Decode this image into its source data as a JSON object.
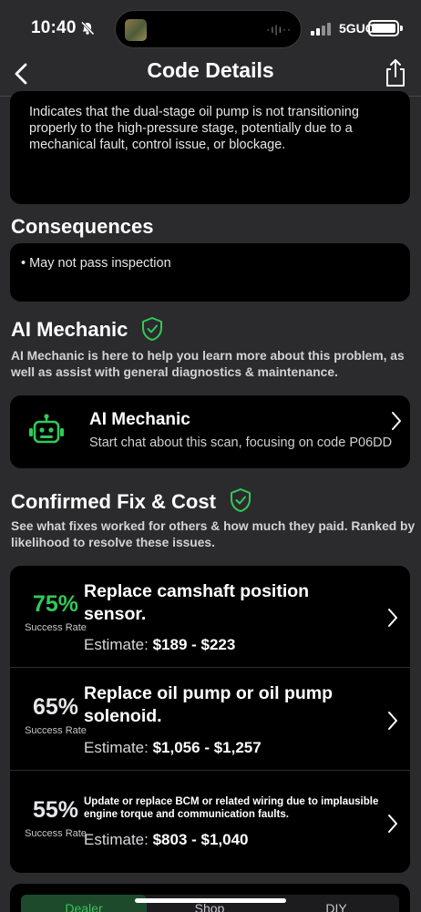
{
  "status_bar": {
    "time": "10:40",
    "network": "5GUC"
  },
  "nav": {
    "title": "Code Details"
  },
  "description": {
    "text": "Indicates that the dual-stage oil pump is not transitioning properly to the high-pressure stage, potentially due to a mechanical fault, control issue, or blockage."
  },
  "consequences": {
    "title": "Consequences",
    "items": [
      "• May not pass inspection"
    ]
  },
  "ai_section": {
    "title": "AI Mechanic",
    "subtitle": "AI Mechanic is here to help you learn more about this problem, as well as assist with general diagnostics & maintenance.",
    "card_title": "AI Mechanic",
    "card_subtitle": "Start chat about this scan, focusing on code P06DD"
  },
  "fix_section": {
    "title": "Confirmed Fix & Cost",
    "subtitle": "See what fixes worked for others & how much they paid. Ranked by likelihood to resolve these issues.",
    "fixes": [
      {
        "pct": "75%",
        "label": "Success Rate",
        "title": "Replace camshaft position sensor.",
        "estimate_label": "Estimate:",
        "estimate": "$189 - $223"
      },
      {
        "pct": "65%",
        "label": "Success Rate",
        "title": "Replace oil pump or oil pump solenoid.",
        "estimate_label": "Estimate:",
        "estimate": "$1,056 - $1,257"
      },
      {
        "pct": "55%",
        "label": "Success Rate",
        "title": "Update or replace BCM or related wiring due to implausible engine torque and communication faults.",
        "estimate_label": "Estimate:",
        "estimate": "$803 - $1,040"
      }
    ]
  },
  "bottom_tabs": [
    "Dealer",
    "Shop",
    "DIY"
  ],
  "colors": {
    "accent_green": "#34c759",
    "card_bg": "#000000",
    "page_bg": "#2b2b2d"
  },
  "icons": [
    "bell-slash-icon",
    "back-chevron-icon",
    "share-icon",
    "shield-check-icon",
    "robot-icon",
    "chevron-right-icon"
  ]
}
